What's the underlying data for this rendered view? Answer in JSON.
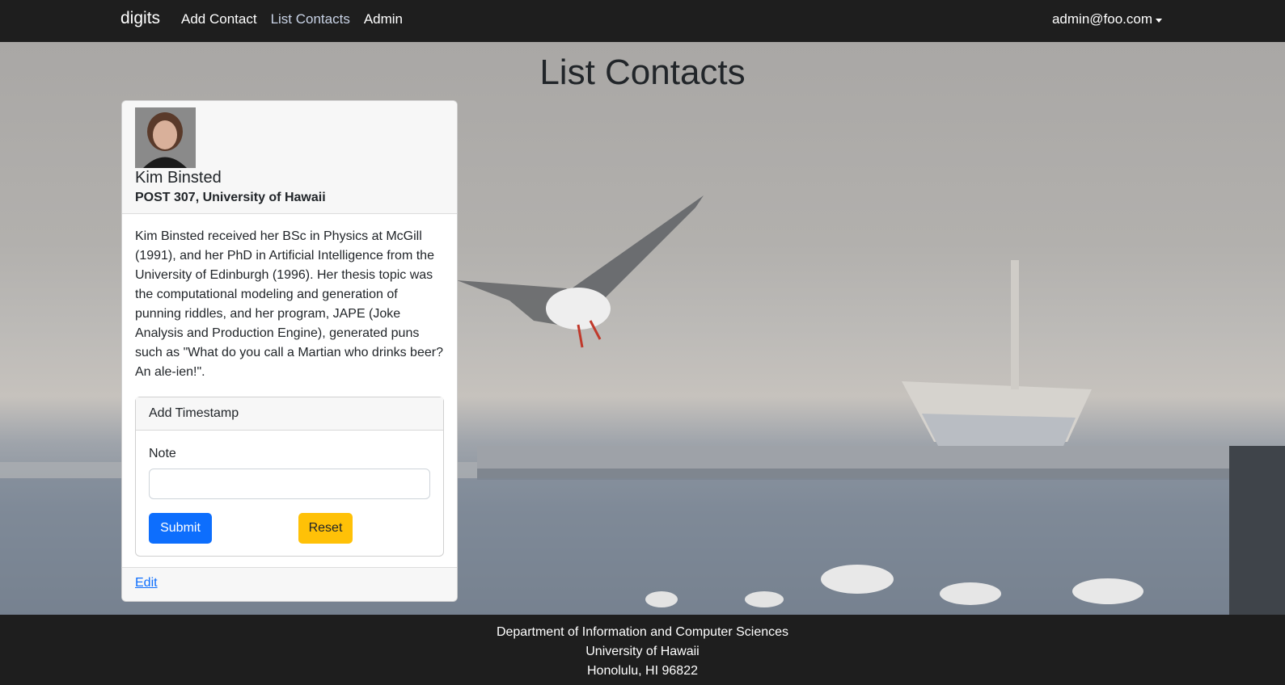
{
  "navbar": {
    "brand": "digits",
    "links": [
      "Add Contact",
      "List Contacts",
      "Admin"
    ],
    "user": "admin@foo.com"
  },
  "page": {
    "title": "List Contacts"
  },
  "contact": {
    "name": "Kim Binsted",
    "address": "POST 307, University of Hawaii",
    "description": "Kim Binsted received her BSc in Physics at McGill (1991), and her PhD in Artificial Intelligence from the University of Edinburgh (1996). Her thesis topic was the computational modeling and generation of punning riddles, and her program, JAPE (Joke Analysis and Production Engine), generated puns such as \"What do you call a Martian who drinks beer? An ale-ien!\".",
    "timestamp": {
      "header": "Add Timestamp",
      "note_label": "Note",
      "note_value": "",
      "submit_label": "Submit",
      "reset_label": "Reset"
    },
    "edit_label": "Edit"
  },
  "footer": {
    "line1": "Department of Information and Computer Sciences",
    "line2": "University of Hawaii",
    "line3": "Honolulu, HI 96822"
  }
}
